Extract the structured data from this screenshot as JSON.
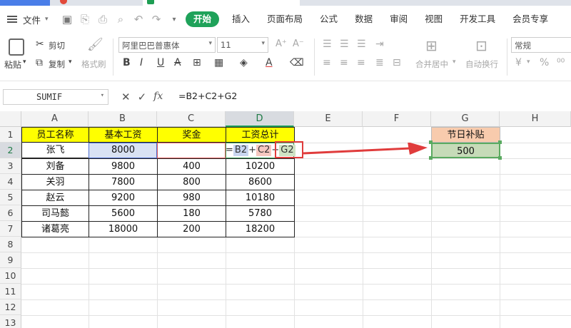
{
  "menu": {
    "file_label": "文件",
    "tabs": [
      "开始",
      "插入",
      "页面布局",
      "公式",
      "数据",
      "审阅",
      "视图",
      "开发工具",
      "会员专享"
    ]
  },
  "ribbon": {
    "paste": "粘贴",
    "cut": "剪切",
    "copy": "复制",
    "format_painter": "格式刷",
    "font_name": "阿里巴巴普惠体",
    "font_size": "11",
    "merge_center": "合并居中",
    "wrap_text": "自动换行",
    "number_format": "常规",
    "currency_symbol": "¥",
    "percent_symbol": "%"
  },
  "formula_bar": {
    "name_box": "SUMIF",
    "cancel_icon": "✕",
    "confirm_icon": "✓",
    "fx_label": "fx",
    "formula": "=B2+C2+G2"
  },
  "sheet": {
    "columns": [
      "A",
      "B",
      "C",
      "D",
      "E",
      "F",
      "G",
      "H"
    ],
    "rows": [
      "1",
      "2",
      "3",
      "4",
      "5",
      "6",
      "7",
      "8",
      "9",
      "10",
      "11",
      "12",
      "13"
    ],
    "headers": [
      "员工名称",
      "基本工资",
      "奖金",
      "工资总计"
    ],
    "data": [
      [
        "张飞",
        "8000",
        "",
        ""
      ],
      [
        "刘备",
        "9800",
        "400",
        "10200"
      ],
      [
        "关羽",
        "7800",
        "800",
        "8600"
      ],
      [
        "赵云",
        "9200",
        "980",
        "10180"
      ],
      [
        "司马懿",
        "5600",
        "180",
        "5780"
      ],
      [
        "诸葛亮",
        "18000",
        "200",
        "18200"
      ]
    ],
    "editing_cell": {
      "prefix": "=",
      "ref1": "B2",
      "op1": "+",
      "ref2": "C2",
      "op2": "+",
      "ref3": "G2"
    },
    "bonus_header": "节日补贴",
    "bonus_value": "500"
  },
  "colors": {
    "accent": "#1fa25a",
    "header_fill": "#ffff00",
    "bonus_header_fill": "#f8cbad",
    "bonus_value_fill": "#c6dbb8",
    "arrow": "#e03c3c"
  }
}
